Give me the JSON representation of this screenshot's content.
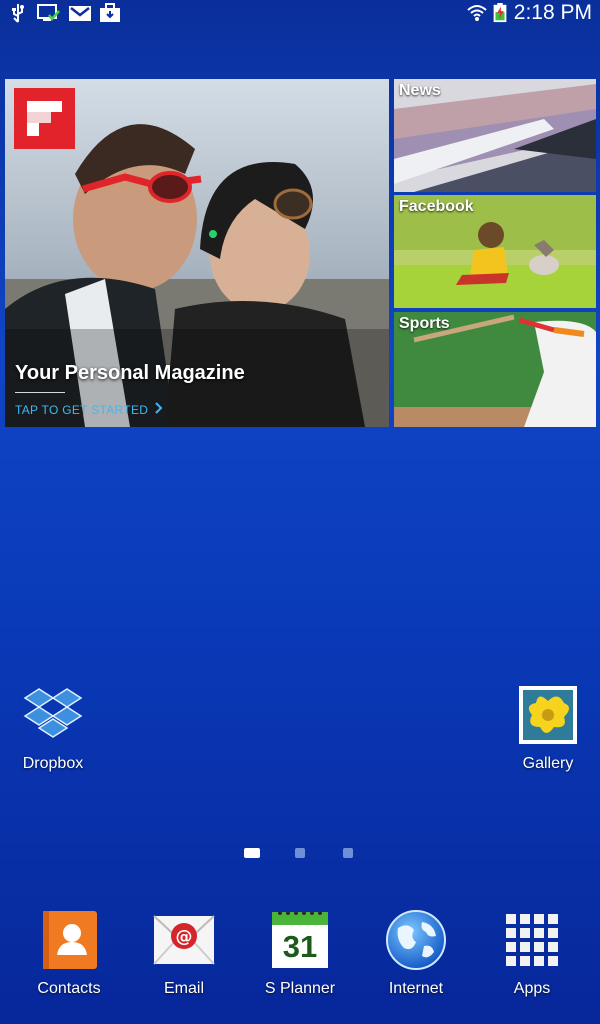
{
  "status_bar": {
    "time": "2:18 PM",
    "icons_left": [
      "usb-icon",
      "screen-sync-icon",
      "gmail-icon",
      "bag-icon"
    ],
    "icons_right": [
      "wifi-icon",
      "battery-charging-icon"
    ]
  },
  "flipboard": {
    "headline": "Your Personal Magazine",
    "cta": "TAP TO GET STARTED",
    "tiles": [
      {
        "label": "News"
      },
      {
        "label": "Facebook"
      },
      {
        "label": "Sports"
      }
    ]
  },
  "desktop_apps": [
    {
      "label": "Dropbox",
      "icon": "dropbox-icon"
    },
    {
      "label": "Gallery",
      "icon": "gallery-icon"
    }
  ],
  "page_indicator": {
    "pages": 3,
    "current": 1
  },
  "dock": [
    {
      "label": "Contacts",
      "icon": "contacts-icon"
    },
    {
      "label": "Email",
      "icon": "email-icon"
    },
    {
      "label": "S Planner",
      "icon": "calendar-icon",
      "day": "31"
    },
    {
      "label": "Internet",
      "icon": "globe-icon"
    },
    {
      "label": "Apps",
      "icon": "apps-grid-icon"
    }
  ],
  "colors": {
    "wallpaper_top": "#0a2f9b",
    "wallpaper_mid": "#0f45c6",
    "flipboard_red": "#e3232c",
    "cta_blue": "#3fb8f5"
  }
}
